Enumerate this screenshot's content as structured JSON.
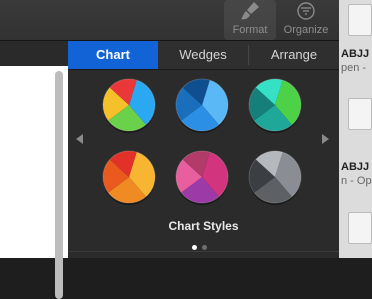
{
  "toolbar": {
    "format_label": "Format",
    "organize_label": "Organize"
  },
  "panel": {
    "tabs": [
      {
        "label": "Chart",
        "active": true
      },
      {
        "label": "Wedges",
        "active": false
      },
      {
        "label": "Arrange",
        "active": false
      }
    ],
    "styles_caption": "Chart Styles",
    "page_count": 2,
    "current_page": 1
  },
  "chart_styles": [
    {
      "name": "rainbow",
      "colors": [
        "#2aa8f2",
        "#6ad14a",
        "#f5c02a",
        "#e9373a"
      ]
    },
    {
      "name": "blues",
      "colors": [
        "#5ab8f7",
        "#2c8fe6",
        "#1a6fbd",
        "#0f4f8f"
      ]
    },
    {
      "name": "greens",
      "colors": [
        "#4dd146",
        "#1fa89a",
        "#177f7a",
        "#35e0c5"
      ]
    },
    {
      "name": "warm",
      "colors": [
        "#f7b532",
        "#f08a22",
        "#ea5a1f",
        "#e23129"
      ]
    },
    {
      "name": "pinks",
      "colors": [
        "#d2357e",
        "#9c3aa8",
        "#e85fa0",
        "#b23b6a"
      ]
    },
    {
      "name": "grays",
      "colors": [
        "#8a8e94",
        "#5d6166",
        "#3b3e42",
        "#b5b9be"
      ]
    }
  ],
  "right_strip": {
    "fragment_1_title": "ABJJ",
    "fragment_1_sub": "pen - ",
    "fragment_2_title": "ABJJ",
    "fragment_2_sub": "n - Op"
  },
  "colors": {
    "accent": "#1264d6",
    "dot_active": "#ffffff",
    "dot_inactive": "#6e6e6e"
  }
}
